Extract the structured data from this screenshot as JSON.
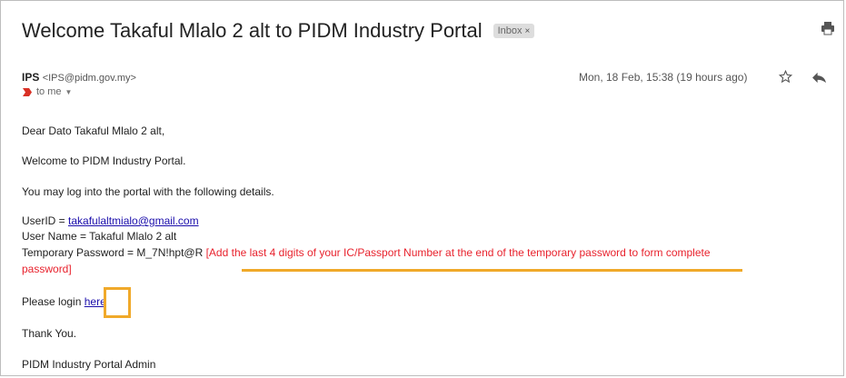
{
  "email": {
    "subject": "Welcome Takaful Mlalo 2 alt to PIDM Industry Portal",
    "inbox_chip": "Inbox",
    "inbox_chip_close": "×",
    "sender_name": "IPS",
    "sender_email": "<IPS@pidm.gov.my>",
    "to_label": "to me",
    "date": "Mon, 18 Feb, 15:38 (19 hours ago)",
    "icons": [
      "print-icon",
      "star-icon",
      "reply-icon",
      "label-important-icon",
      "chevron-down-icon"
    ]
  },
  "body": {
    "greeting": "Dear Dato Takaful Mlalo 2 alt,",
    "welcome": "Welcome to PIDM Industry Portal.",
    "instructions": "You may log into the portal with the following details.",
    "userid_label": "UserID = ",
    "userid_value": "takafulaltmialo@gmail.com",
    "username_line": "User Name = Takaful Mlalo 2 alt",
    "temp_password_label": "Temporary Password = M_7N!hpt@R ",
    "temp_password_note_1": "[Add the last 4 digits of your IC/Passport Number at the end of the temporary password to form complete",
    "temp_password_note_2": "password]",
    "login_prefix": "Please login ",
    "login_link": "here",
    "thanks": "Thank You.",
    "signature": "PIDM Industry Portal Admin"
  },
  "colors": {
    "link": "#1a0dab",
    "note_red": "#e8222d",
    "highlight_orange": "#f0a92a"
  }
}
